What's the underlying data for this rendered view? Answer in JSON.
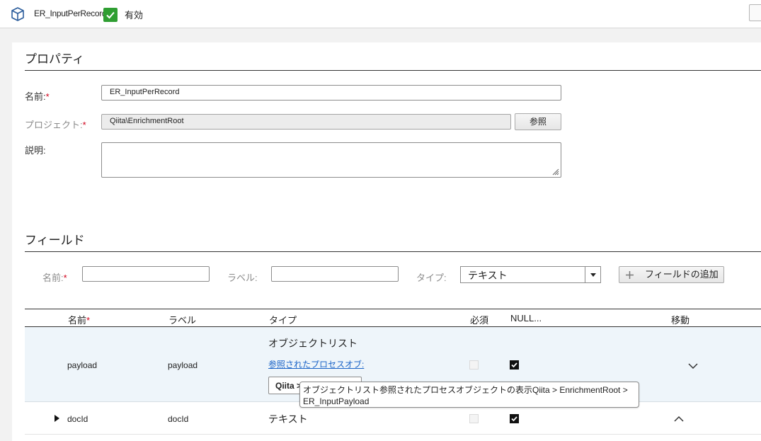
{
  "header": {
    "object_name": "ER_InputPerRecord",
    "status_label": "有効",
    "icon": "cube-icon",
    "status_icon": "check-icon"
  },
  "properties": {
    "section_title": "プロパティ",
    "name_label": "名前:",
    "name_value": "ER_InputPerRecord",
    "project_label": "プロジェクト:",
    "project_value": "Qiita\\EnrichmentRoot",
    "browse_button": "参照",
    "description_label": "説明:",
    "description_value": ""
  },
  "fields": {
    "section_title": "フィールド",
    "add_form": {
      "name_label": "名前:",
      "name_value": "",
      "label_label": "ラベル:",
      "label_value": "",
      "type_label": "タイプ:",
      "type_selected": "テキスト",
      "add_button": "フィールドの追加"
    },
    "columns": [
      "名前",
      "ラベル",
      "タイプ",
      "必須",
      "NULL...",
      "移動"
    ],
    "rows": [
      {
        "name": "payload",
        "label": "payload",
        "type": "オブジェクトリスト",
        "type_link": "参照されたプロセスオブ:",
        "object_button": "Qiita >",
        "required": false,
        "nullable": true,
        "move": "chevron-down-icon"
      },
      {
        "name": "docId",
        "label": "docId",
        "type": "テキスト",
        "required": false,
        "nullable": true,
        "move": "chevron-up-icon"
      }
    ]
  },
  "tooltip": {
    "line1": "オブジェクトリスト参照されたプロセスオブジェクトの表示Qiita > EnrichmentRoot >",
    "line2": "ER_InputPayload"
  },
  "colors": {
    "accent_green": "#2f9e32",
    "link_blue": "#1a63c7",
    "required_red": "#d0021b",
    "selected_row": "#eef5fa"
  }
}
